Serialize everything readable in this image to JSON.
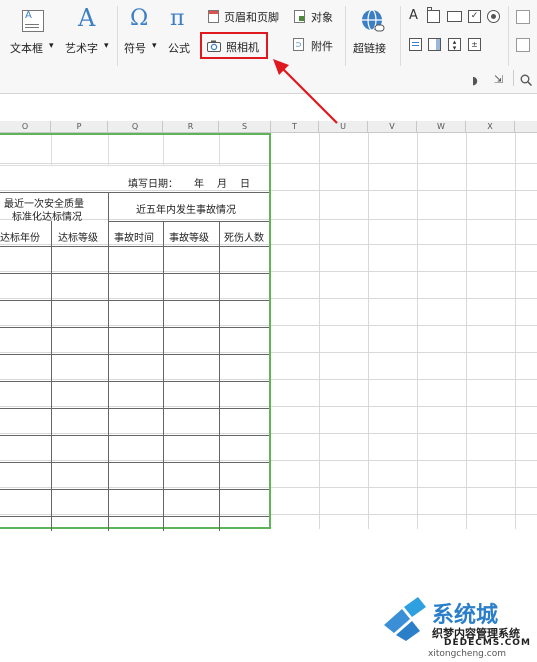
{
  "ribbon": {
    "textbox_label": "文本框",
    "wordart_label": "艺术字",
    "symbol_label": "符号",
    "formula_label": "公式",
    "header_footer_label": "页眉和页脚",
    "object_label": "对象",
    "camera_label": "照相机",
    "attachment_label": "附件",
    "hyperlink_label": "超链接",
    "dropdown_glyph": "▾",
    "wordart_glyph": "A",
    "symbol_glyph": "Ω",
    "formula_glyph": "π",
    "shape_text_glyph": "A"
  },
  "grid": {
    "column_headers": [
      "O",
      "P",
      "Q",
      "R",
      "S",
      "T",
      "U",
      "V",
      "W",
      "X"
    ]
  },
  "table": {
    "fill_date_label": "填写日期：",
    "year_label": "年",
    "month_label": "月",
    "day_label": "日",
    "header_left_line1": "最近一次安全质量",
    "header_left_line2": "标准化达标情况",
    "header_right": "近五年内发生事故情况",
    "sub_headers": [
      "达标年份",
      "达标等级",
      "事故时间",
      "事故等级",
      "死伤人数"
    ]
  },
  "watermark": {
    "brand_text": "系统城",
    "site_text_1": "织梦内容管理系统",
    "site_text_2": "DEDECMS.COM",
    "url_text": "xitongcheng.com"
  },
  "colors": {
    "highlight_red": "#e0191f",
    "table_green": "#5fb45a",
    "icon_blue": "#3d7fc4"
  }
}
